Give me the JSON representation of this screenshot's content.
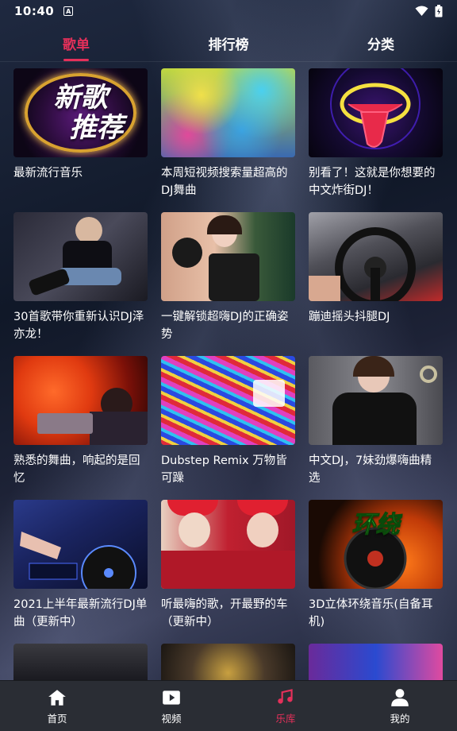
{
  "status_bar": {
    "time": "10:40",
    "notification_letter": "A"
  },
  "tabs": [
    {
      "label": "歌单",
      "active": true
    },
    {
      "label": "排行榜",
      "active": false
    },
    {
      "label": "分类",
      "active": false
    }
  ],
  "playlists": [
    {
      "title": "最新流行音乐",
      "cover_text": "新歌\n推荐",
      "icon": "new-songs-cover"
    },
    {
      "title": "本周短视频搜索量超高的DJ舞曲",
      "cover_text": "",
      "icon": "color-powder-cover"
    },
    {
      "title": "别看了！这就是你想要的中文炸街DJ！",
      "cover_text": "",
      "icon": "neon-lips-cover"
    },
    {
      "title": "30首歌带你重新认识DJ泽亦龙！",
      "cover_text": "",
      "icon": "woman-photo-cover"
    },
    {
      "title": "一键解锁超嗨DJ的正确姿势",
      "cover_text": "",
      "icon": "boxing-girl-cover"
    },
    {
      "title": "蹦迪摇头抖腿DJ",
      "cover_text": "",
      "icon": "car-wheel-cover"
    },
    {
      "title": "熟悉的舞曲，响起的是回忆",
      "cover_text": "",
      "icon": "dj-red-light-cover"
    },
    {
      "title": "Dubstep Remix  万物皆可躁",
      "cover_text": "",
      "icon": "psychedelic-cover"
    },
    {
      "title": "中文DJ，7妹劲爆嗨曲精选",
      "cover_text": "",
      "icon": "woman-black-dress-cover"
    },
    {
      "title": "2021上半年最新流行DJ单曲（更新中）",
      "cover_text": "",
      "icon": "dj-turntable-cover"
    },
    {
      "title": "听最嗨的歌，开最野的车（更新中）",
      "cover_text": "",
      "icon": "two-girls-cover"
    },
    {
      "title": "3D立体环绕音乐(自备耳机)",
      "cover_text": "环绕",
      "icon": "vinyl-fire-cover"
    }
  ],
  "bottom_nav": [
    {
      "label": "首页",
      "icon": "home-icon",
      "active": false
    },
    {
      "label": "视频",
      "icon": "video-icon",
      "active": false
    },
    {
      "label": "乐库",
      "icon": "music-note-icon",
      "active": true
    },
    {
      "label": "我的",
      "icon": "person-icon",
      "active": false
    }
  ],
  "colors": {
    "accent": "#e5305a",
    "nav_bg": "#2a2d34"
  }
}
